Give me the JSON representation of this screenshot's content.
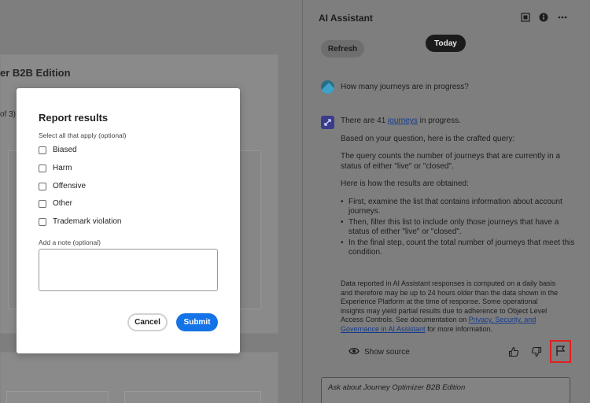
{
  "background_page": {
    "title": "er B2B Edition",
    "pagination": "of 3)"
  },
  "assistant": {
    "title": "AI Assistant",
    "header_icons": [
      "expand-icon",
      "info-icon",
      "more-icon"
    ],
    "refresh_label": "Refresh",
    "today_label": "Today",
    "user_question": "How many journeys are in progress?",
    "answer": {
      "intro_prefix": "There are 41 ",
      "intro_link": "journeys",
      "intro_suffix": " in progress.",
      "query_intro": "Based on your question, here is the crafted query:",
      "query_desc": "The query counts the number of journeys that are currently in a status of either \"live\" or \"closed\".",
      "steps_intro": "Here is how the results are obtained:",
      "steps": [
        "First, examine the list that contains information about account journeys.",
        "Then, filter this list to include only those journeys that have a status of either \"live\" or \"closed\".",
        "In the final step, count the total number of journeys that meet this condition."
      ]
    },
    "disclaimer": {
      "text": "Data reported in AI Assistant responses is computed on a daily basis and therefore may be up to 24 hours older than the data shown in the Experience Platform at the time of response. Some operational insights may yield partial results due to adherence to Object Level Access Controls. See documentation on ",
      "link": "Privacy, Security, and Governance in AI Assistant",
      "suffix": " for more information."
    },
    "show_source_label": "Show source",
    "input_placeholder": "Ask about Journey Optimizer B2B Edition"
  },
  "modal": {
    "title": "Report results",
    "subtitle": "Select all that apply (optional)",
    "options": [
      "Biased",
      "Harm",
      "Offensive",
      "Other",
      "Trademark violation"
    ],
    "note_label": "Add a note (optional)",
    "cancel_label": "Cancel",
    "submit_label": "Submit"
  },
  "colors": {
    "overlay": "#7e7e7e",
    "accent": "#1473e6",
    "highlight": "#e02020"
  }
}
